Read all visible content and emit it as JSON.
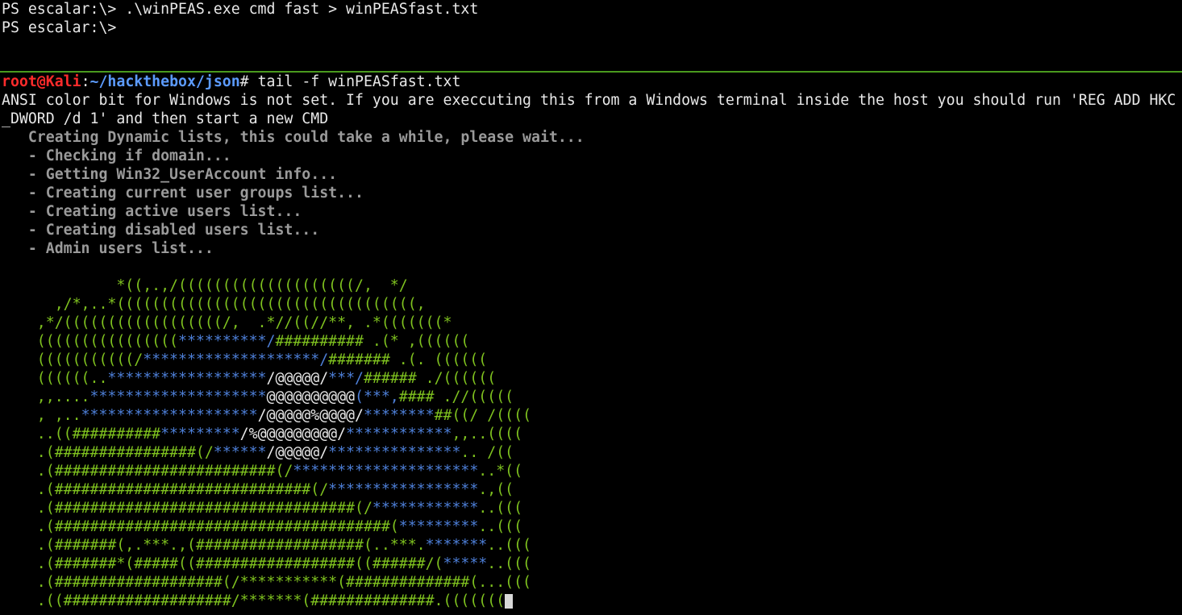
{
  "top_pane": {
    "lines": [
      "PS escalar:\\> .\\winPEAS.exe cmd fast > winPEASfast.txt",
      "PS escalar:\\>"
    ]
  },
  "bottom_pane": {
    "prompt": {
      "user_host": "root@Kali",
      "separator": ":",
      "path": "~/hackthebox/json",
      "symbol": "#",
      "command": " tail -f winPEASfast.txt"
    },
    "output_lines": [
      "ANSI color bit for Windows is not set. If you are execcuting this from a Windows terminal inside the host you should run 'REG ADD HKC",
      "_DWORD /d 1' and then start a new CMD"
    ],
    "progress_lines": [
      "   Creating Dynamic lists, this could take a while, please wait...",
      "   - Checking if domain...",
      "   - Getting Win32_UserAccount info...",
      "   - Creating current user groups list...",
      "   - Creating active users list...",
      "   - Creating disabled users list...",
      "   - Admin users list..."
    ],
    "ascii_art": [
      [
        [
          "g",
          "             *((,.,/((((((((((((((((((((/,  */"
        ]
      ],
      [
        [
          "g",
          "      ,/*,..*((((((((((((((((((((((((((((((((((,"
        ]
      ],
      [
        [
          "g",
          "    ,*/((((((((((((((((((/,  .*//((//**, .*(((((((*"
        ]
      ],
      [
        [
          "g",
          "    (((((((((((((((("
        ],
        [
          "b",
          "**********/"
        ],
        [
          "g",
          "########## .(* ,(((((("
        ]
      ],
      [
        [
          "g",
          "    (((((((((((/"
        ],
        [
          "b",
          "********************/"
        ],
        [
          "g",
          "####### .(. (((((("
        ]
      ],
      [
        [
          "g",
          "    ((((((.."
        ],
        [
          "b",
          "******************"
        ],
        [
          "w",
          "/@@@@@/"
        ],
        [
          "b",
          "***/"
        ],
        [
          "g",
          "###### ./(((((("
        ]
      ],
      [
        [
          "g",
          "    ,,...."
        ],
        [
          "b",
          "********************"
        ],
        [
          "w",
          "@@@@@@@@@@"
        ],
        [
          "b",
          "(***,"
        ],
        [
          "g",
          "#### .//((((("
        ]
      ],
      [
        [
          "g",
          "    , ,.."
        ],
        [
          "b",
          "********************"
        ],
        [
          "w",
          "/@@@@@%@@@@/"
        ],
        [
          "b",
          "********"
        ],
        [
          "g",
          "##((/ /(((("
        ]
      ],
      [
        [
          "g",
          "    ..((##########"
        ],
        [
          "b",
          "*********"
        ],
        [
          "w",
          "/%@@@@@@@@@/"
        ],
        [
          "b",
          "************"
        ],
        [
          "g",
          ",,..(((("
        ]
      ],
      [
        [
          "g",
          "    .(################(/"
        ],
        [
          "b",
          "******"
        ],
        [
          "w",
          "/@@@@@/"
        ],
        [
          "b",
          "***************"
        ],
        [
          "g",
          ".. /(("
        ]
      ],
      [
        [
          "g",
          "    .(#########################(/"
        ],
        [
          "b",
          "*********************"
        ],
        [
          "g",
          "..*(("
        ]
      ],
      [
        [
          "g",
          "    .(#############################(/"
        ],
        [
          "b",
          "*****************"
        ],
        [
          "g",
          ".,(("
        ]
      ],
      [
        [
          "g",
          "    .(##################################(/"
        ],
        [
          "b",
          "************"
        ],
        [
          "g",
          "..((("
        ]
      ],
      [
        [
          "g",
          "    .(######################################("
        ],
        [
          "b",
          "*********"
        ],
        [
          "g",
          "..((("
        ]
      ],
      [
        [
          "g",
          "    .(#######(,.***.,(###################(..***."
        ],
        [
          "b",
          "*******"
        ],
        [
          "g",
          "..((("
        ]
      ],
      [
        [
          "g",
          "    .(#######*(#####((##################((######/("
        ],
        [
          "b",
          "*****"
        ],
        [
          "g",
          "..((("
        ]
      ],
      [
        [
          "g",
          "    .(###################(/***********(##############(...((("
        ]
      ],
      [
        [
          "g",
          "    .((###################/*******(##############.((((((("
        ]
      ]
    ]
  },
  "colors": {
    "background": "#000000",
    "text": "#e8e8e8",
    "user_host": "#ff2b2b",
    "path": "#5c9bff",
    "divider": "#4a9a1e",
    "art_green": "#7fc21f",
    "art_blue": "#4d7fd8",
    "dim_text": "#9a9a9a"
  }
}
